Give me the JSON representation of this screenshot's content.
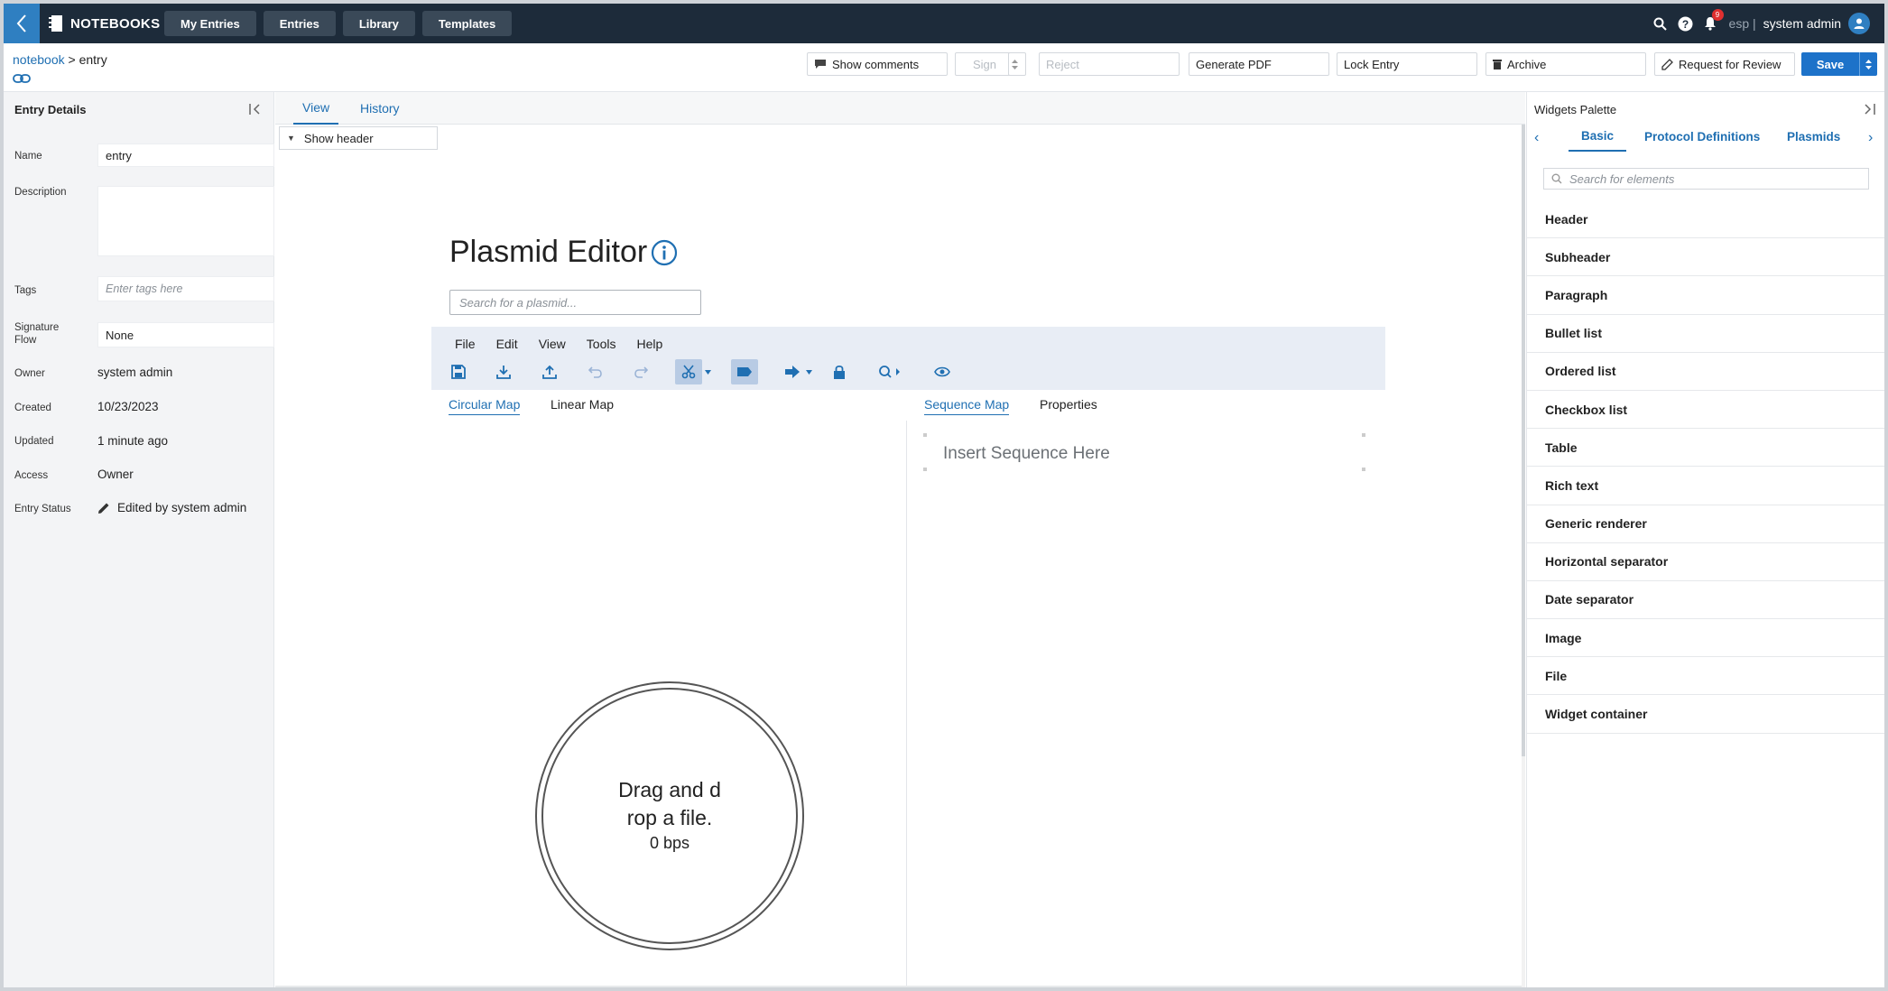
{
  "topbar": {
    "app_name": "NOTEBOOKS",
    "nav": [
      "My Entries",
      "Entries",
      "Library",
      "Templates"
    ],
    "notifications_count": "9",
    "language": "esp |",
    "user": "system admin"
  },
  "breadcrumb": {
    "notebook": "notebook",
    "separator": ">",
    "entry": "entry"
  },
  "actions": {
    "show_comments": "Show comments",
    "sign": "Sign",
    "reject": "Reject",
    "generate_pdf": "Generate PDF",
    "lock_entry": "Lock Entry",
    "archive": "Archive",
    "request_review": "Request for Review",
    "save": "Save"
  },
  "entry_details": {
    "title": "Entry Details",
    "fields": {
      "name_label": "Name",
      "name_value": "entry",
      "description_label": "Description",
      "description_value": "",
      "tags_label": "Tags",
      "tags_placeholder": "Enter tags here",
      "signature_label_1": "Signature",
      "signature_label_2": "Flow",
      "signature_value": "None",
      "owner_label": "Owner",
      "owner_value": "system admin",
      "created_label": "Created",
      "created_value": "10/23/2023",
      "updated_label": "Updated",
      "updated_value": "1 minute ago",
      "access_label": "Access",
      "access_value": "Owner",
      "status_label": "Entry Status",
      "status_value": "Edited by system admin"
    }
  },
  "center": {
    "tabs": [
      "View",
      "History"
    ],
    "show_header": "Show header",
    "plasmid_title": "Plasmid Editor",
    "plasmid_search_placeholder": "Search for a plasmid...",
    "menu": [
      "File",
      "Edit",
      "View",
      "Tools",
      "Help"
    ],
    "left_tabs": [
      "Circular Map",
      "Linear Map"
    ],
    "right_tabs": [
      "Sequence Map",
      "Properties"
    ],
    "sequence_placeholder": "Insert Sequence Here",
    "drop_line1": "Drag and d",
    "drop_line2": "rop a file.",
    "bps": "0 bps"
  },
  "widgets": {
    "title": "Widgets Palette",
    "tabs": [
      "Basic",
      "Protocol Definitions",
      "Plasmids"
    ],
    "search_placeholder": "Search for elements",
    "items": [
      "Header",
      "Subheader",
      "Paragraph",
      "Bullet list",
      "Ordered list",
      "Checkbox list",
      "Table",
      "Rich text",
      "Generic renderer",
      "Horizontal separator",
      "Date separator",
      "Image",
      "File",
      "Widget container"
    ]
  },
  "colors": {
    "topbar": "#1d2b3a",
    "accent": "#1f6fb2",
    "save": "#1d72c9",
    "editor_menu": "#e8edf5"
  }
}
